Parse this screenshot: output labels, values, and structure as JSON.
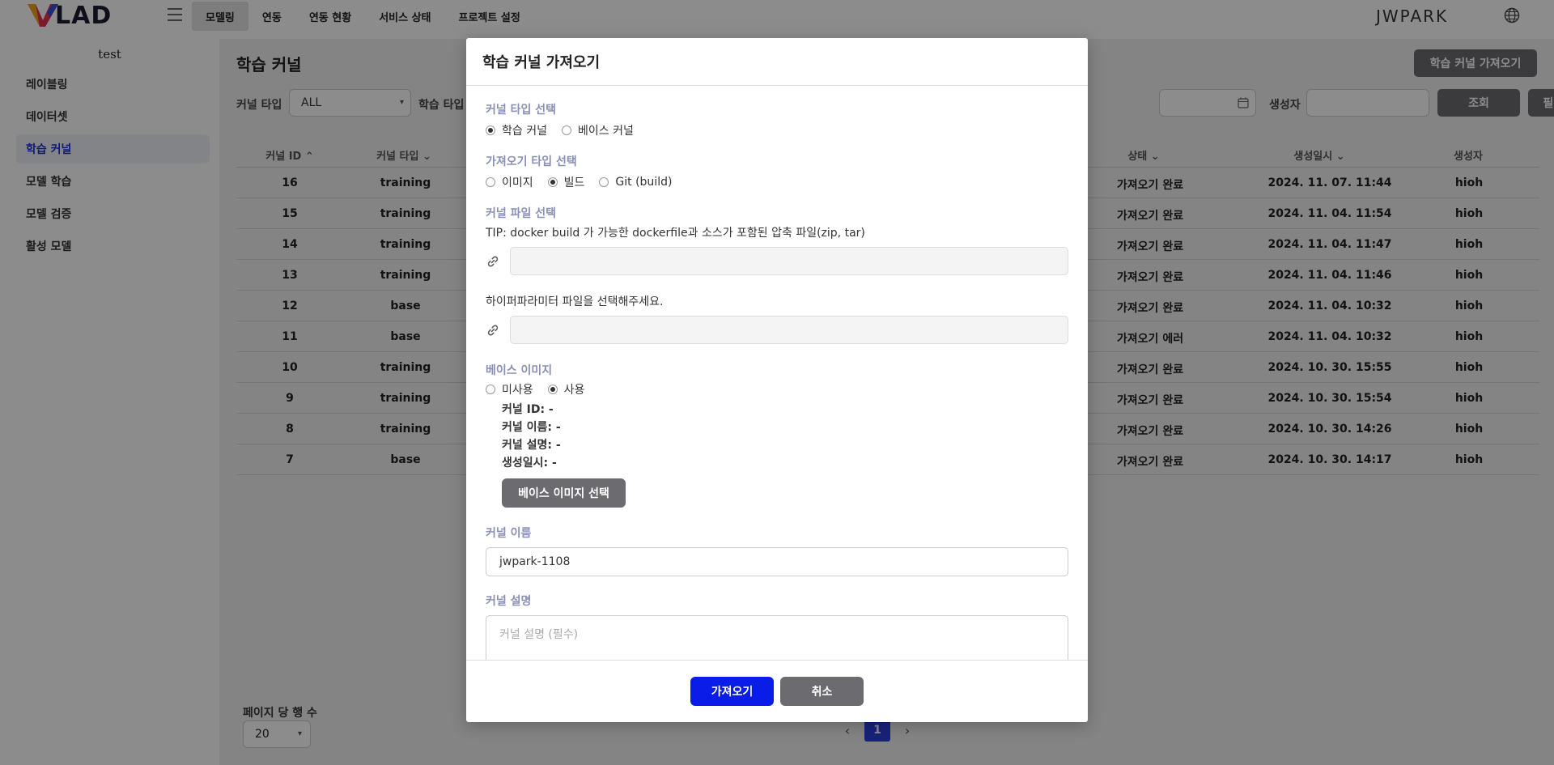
{
  "app": {
    "logo_text": "LAD",
    "user": "JWPARK"
  },
  "top_menu": [
    "모델링",
    "연동",
    "연동 현황",
    "서비스 상태",
    "프로젝트 설정"
  ],
  "sidebar": {
    "project": "test",
    "items": [
      "레이블링",
      "데이터셋",
      "학습 커널",
      "모델 학습",
      "모델 검증",
      "활성 모델"
    ]
  },
  "page": {
    "title": "학습 커널",
    "import_button": "학습 커널 가져오기",
    "filters": {
      "kernel_type_label": "커널 타입",
      "kernel_type_value": "ALL",
      "learning_type_label": "학습 타입",
      "creator_label": "생성자",
      "search_button": "조회",
      "reset_button": "필터 초기화"
    },
    "table": {
      "headers": [
        "커널 ID",
        "커널 타입",
        "상태",
        "생성일시",
        "생성자"
      ],
      "rows": [
        {
          "id": "16",
          "type": "training",
          "status": "가져오기 완료",
          "date": "2024. 11. 07. 11:44",
          "creator": "hioh"
        },
        {
          "id": "15",
          "type": "training",
          "status": "가져오기 완료",
          "date": "2024. 11. 04. 11:54",
          "creator": "hioh"
        },
        {
          "id": "14",
          "type": "training",
          "status": "가져오기 완료",
          "date": "2024. 11. 04. 11:47",
          "creator": "hioh"
        },
        {
          "id": "13",
          "type": "training",
          "status": "가져오기 완료",
          "date": "2024. 11. 04. 11:46",
          "creator": "hioh"
        },
        {
          "id": "12",
          "type": "base",
          "status": "가져오기 완료",
          "date": "2024. 11. 04. 10:32",
          "creator": "hioh"
        },
        {
          "id": "11",
          "type": "base",
          "status": "가져오기 에러",
          "date": "2024. 11. 04. 10:32",
          "creator": "hioh"
        },
        {
          "id": "10",
          "type": "training",
          "status": "가져오기 완료",
          "date": "2024. 10. 30. 15:55",
          "creator": "hioh"
        },
        {
          "id": "9",
          "type": "training",
          "status": "가져오기 완료",
          "date": "2024. 10. 30. 15:54",
          "creator": "hioh"
        },
        {
          "id": "8",
          "type": "training",
          "status": "가져오기 완료",
          "date": "2024. 10. 30. 14:26",
          "creator": "hioh"
        },
        {
          "id": "7",
          "type": "base",
          "status": "가져오기 완료",
          "date": "2024. 10. 30. 14:17",
          "creator": "hioh"
        }
      ]
    },
    "rows_per_page_label": "페이지 당 행 수",
    "rows_per_page_value": "20",
    "current_page": "1"
  },
  "modal": {
    "title": "학습 커널 가져오기",
    "kernel_type": {
      "label": "커널 타입 선택",
      "options": [
        "학습 커널",
        "베이스 커널"
      ],
      "selected": 0
    },
    "import_type": {
      "label": "가져오기 타입 선택",
      "options": [
        "이미지",
        "빌드",
        "Git (build)"
      ],
      "selected": 1
    },
    "kernel_file": {
      "label": "커널 파일 선택",
      "tip": "TIP: docker build 가 가능한 dockerfile과 소스가 포함된 압축 파일(zip, tar)"
    },
    "hyperparam_label": "하이퍼파라미터 파일을 선택해주세요.",
    "base_image": {
      "label": "베이스 이미지",
      "options": [
        "미사용",
        "사용"
      ],
      "selected": 1,
      "info": [
        "커널 ID: -",
        "커널 이름: -",
        "커널 설명: -",
        "생성일시: -"
      ],
      "select_button": "베이스 이미지 선택"
    },
    "kernel_name": {
      "label": "커널 이름",
      "value": "jwpark-1108"
    },
    "kernel_desc": {
      "label": "커널 설명",
      "placeholder": "커널 설명 (필수)"
    },
    "confirm_button": "가져오기",
    "cancel_button": "취소"
  },
  "colors": {
    "accent": "#0a1de8",
    "button_gray": "#6c6c70",
    "section_label": "#8a8fb5"
  }
}
